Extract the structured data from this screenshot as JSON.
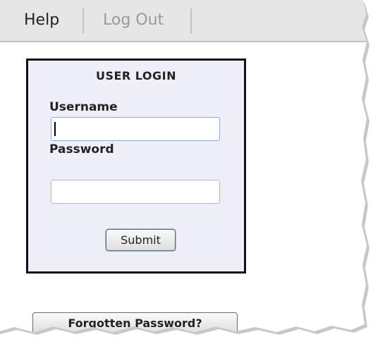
{
  "menu": {
    "help_label": "Help",
    "logout_label": "Log Out"
  },
  "login": {
    "title": "USER LOGIN",
    "username_label": "Username",
    "username_value": "",
    "password_label": "Password",
    "password_value": "",
    "submit_label": "Submit"
  },
  "forgot": {
    "label": "Forgotten Password?"
  },
  "colors": {
    "menubar_bg": "#e6e6e6",
    "login_box_bg": "#efeffa",
    "login_box_border": "#111111",
    "inactive_menu_text": "#9a9a9a"
  }
}
